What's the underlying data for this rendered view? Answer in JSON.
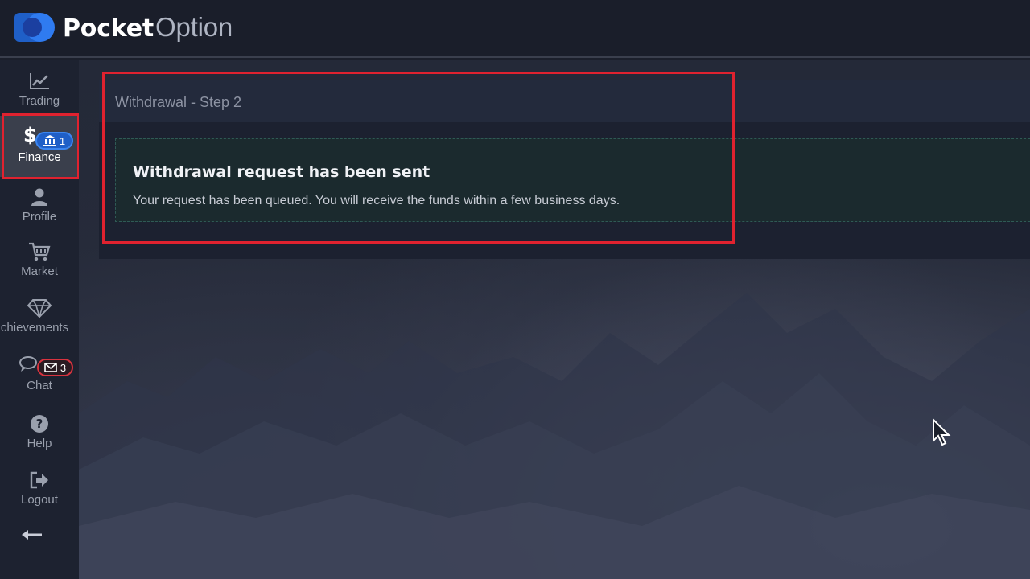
{
  "brand": {
    "name_bold": "Pocket",
    "name_light": "Option"
  },
  "sidebar": {
    "items": [
      {
        "label": "Trading",
        "icon": "chart-line-icon"
      },
      {
        "label": "Finance",
        "icon": "dollar-icon",
        "badge": "1",
        "badge_icon": "bank-icon"
      },
      {
        "label": "Profile",
        "icon": "user-icon"
      },
      {
        "label": "Market",
        "icon": "cart-icon"
      },
      {
        "label": "chievements",
        "icon": "diamond-icon"
      },
      {
        "label": "Chat",
        "icon": "chat-icon",
        "badge": "3",
        "badge_icon": "envelope-icon"
      },
      {
        "label": "Help",
        "icon": "question-icon"
      },
      {
        "label": "Logout",
        "icon": "logout-icon"
      }
    ],
    "collapse_icon": "arrow-left-icon"
  },
  "panel": {
    "title": "Withdrawal - Step 2",
    "message_title": "Withdrawal request has been sent",
    "message_text": "Your request has been queued. You will receive the funds within a few business days."
  },
  "colors": {
    "highlight": "#e0222f",
    "accent_blue": "#1f5fc7",
    "badge_red": "#d9333f"
  }
}
